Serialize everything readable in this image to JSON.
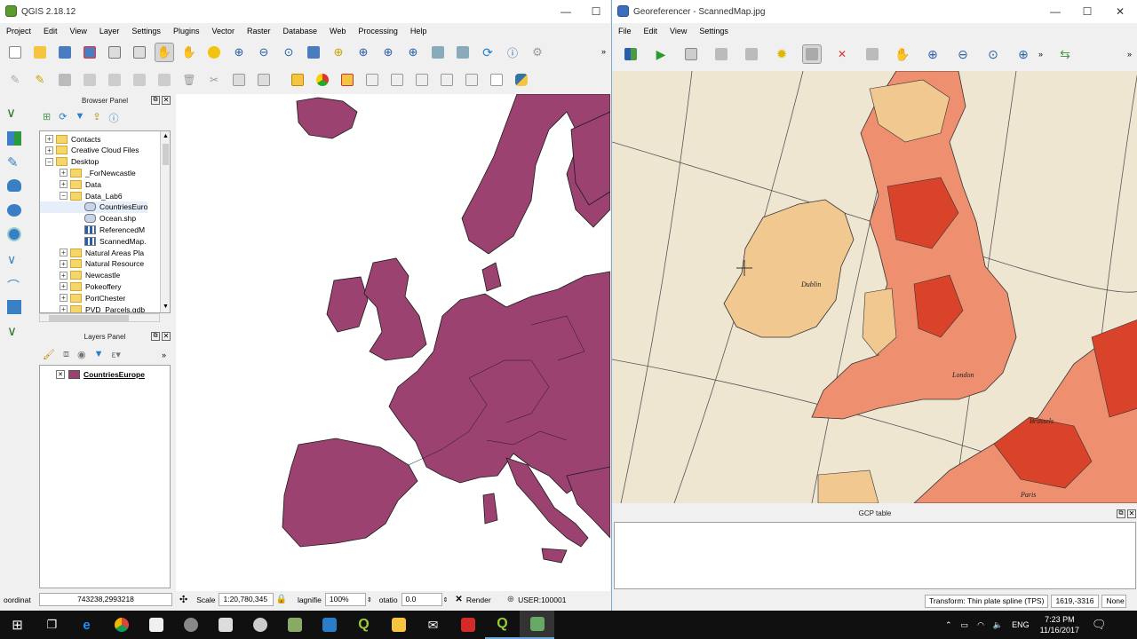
{
  "qgis": {
    "title": "QGIS 2.18.12",
    "menus": [
      "Project",
      "Edit",
      "View",
      "Layer",
      "Settings",
      "Plugins",
      "Vector",
      "Raster",
      "Database",
      "Web",
      "Processing",
      "Help"
    ],
    "browser_panel": {
      "title": "Browser Panel",
      "items": [
        {
          "label": "Contacts",
          "level": 1,
          "kind": "folder",
          "exp": "+"
        },
        {
          "label": "Creative Cloud Files",
          "level": 1,
          "kind": "folder",
          "exp": "+"
        },
        {
          "label": "Desktop",
          "level": 1,
          "kind": "folder",
          "exp": "−"
        },
        {
          "label": "_ForNewcastle",
          "level": 2,
          "kind": "folder",
          "exp": "+"
        },
        {
          "label": "Data",
          "level": 2,
          "kind": "folder",
          "exp": "+"
        },
        {
          "label": "Data_Lab6",
          "level": 2,
          "kind": "folder",
          "exp": "−"
        },
        {
          "label": "CountriesEuro",
          "level": 3,
          "kind": "vector",
          "exp": ""
        },
        {
          "label": "Ocean.shp",
          "level": 3,
          "kind": "vector",
          "exp": ""
        },
        {
          "label": "ReferencedM",
          "level": 3,
          "kind": "raster",
          "exp": ""
        },
        {
          "label": "ScannedMap.",
          "level": 3,
          "kind": "raster",
          "exp": ""
        },
        {
          "label": "Natural Areas Pla",
          "level": 2,
          "kind": "folder",
          "exp": "+"
        },
        {
          "label": "Natural Resource",
          "level": 2,
          "kind": "folder",
          "exp": "+"
        },
        {
          "label": "Newcastle",
          "level": 2,
          "kind": "folder",
          "exp": "+"
        },
        {
          "label": "Pokeoffery",
          "level": 2,
          "kind": "folder",
          "exp": "+"
        },
        {
          "label": "PortChester",
          "level": 2,
          "kind": "folder",
          "exp": "+"
        },
        {
          "label": "PVD_Parcels.gdb",
          "level": 2,
          "kind": "folder",
          "exp": "+"
        }
      ]
    },
    "layers_panel": {
      "title": "Layers Panel",
      "layers": [
        {
          "label": "CountriesEurope",
          "color": "#9c4270",
          "checked": "✕"
        }
      ]
    },
    "status": {
      "coord_label": "oordinat",
      "coord_value": "743238,2993218",
      "scale_label": "Scale",
      "scale_value": "1:20,780,345",
      "magnifier_label": "lagnifie",
      "magnifier_value": "100%",
      "rotation_label": "otatio",
      "rotation_value": "0.0",
      "render_label": "Render",
      "crs_label": "USER:100001"
    },
    "map_color": "#9c4270"
  },
  "georef": {
    "title": "Georeferencer - ScannedMap.jpg",
    "menus": [
      "File",
      "Edit",
      "View",
      "Settings"
    ],
    "gcp_table_title": "GCP table",
    "status": {
      "transform": "Transform: Thin plate spline (TPS)",
      "coords": "1619,-3316",
      "crs": "None"
    },
    "map_labels": {
      "london": "London",
      "paris": "Paris",
      "dublin": "Dublin",
      "brussels": "Brussels"
    }
  },
  "taskbar": {
    "lang": "ENG",
    "time": "7:23 PM",
    "date": "11/16/2017"
  }
}
